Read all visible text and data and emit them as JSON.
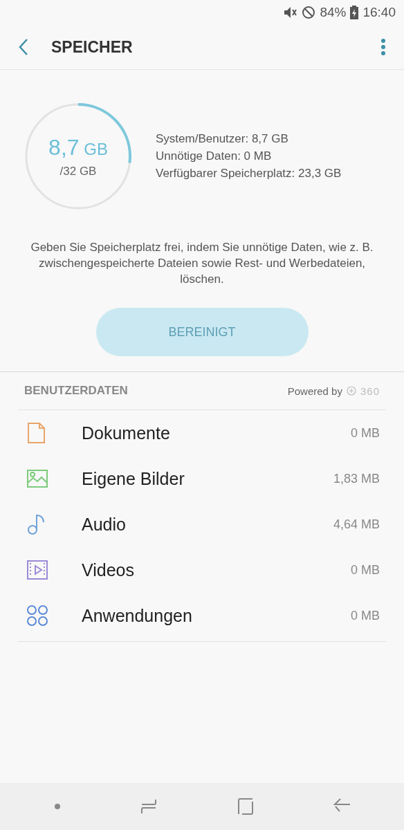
{
  "status_bar": {
    "battery": "84%",
    "time": "16:40"
  },
  "header": {
    "title": "SPEICHER"
  },
  "storage": {
    "used": "8,7",
    "used_unit": "GB",
    "total": "/32 GB",
    "level": 0.27,
    "details": [
      "System/Benutzer: 8,7 GB",
      "Unnötige Daten: 0 MB",
      "Verfügbarer Speicherplatz: 23,3 GB"
    ]
  },
  "hint": "Geben Sie Speicherplatz frei, indem Sie unnötige Daten, wie z. B. zwischengespeicherte Dateien sowie Rest- und Werbedateien, löschen.",
  "clean_button": {
    "label": "BEREINIGT",
    "disabled": true
  },
  "section": {
    "title": "BENUTZERDATEN",
    "powered_by": "Powered by",
    "brand": "360"
  },
  "categories": [
    {
      "kind": "document",
      "color": "#e8a56a",
      "name": "Dokumente",
      "size": "0 MB"
    },
    {
      "kind": "image",
      "color": "#7ccb7c",
      "name": "Eigene Bilder",
      "size": "1,83 MB"
    },
    {
      "kind": "audio",
      "color": "#6fa3d8",
      "name": "Audio",
      "size": "4,64 MB"
    },
    {
      "kind": "video",
      "color": "#9b8ad6",
      "name": "Videos",
      "size": "0 MB"
    },
    {
      "kind": "apps",
      "color": "#5b8ad8",
      "name": "Anwendungen",
      "size": "0 MB"
    }
  ]
}
